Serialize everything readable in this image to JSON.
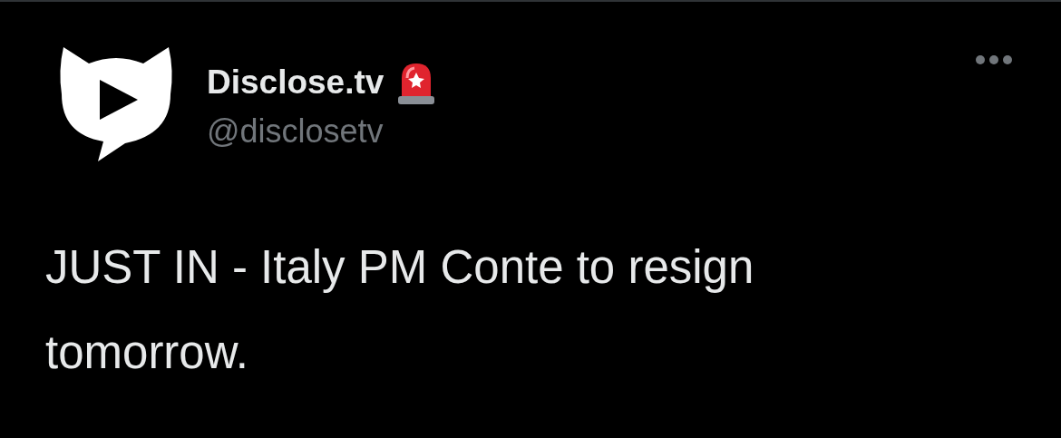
{
  "author": {
    "name": "Disclose.tv",
    "handle": "@disclosetv"
  },
  "text": "JUST IN - Italy PM Conte to resign tomorrow."
}
